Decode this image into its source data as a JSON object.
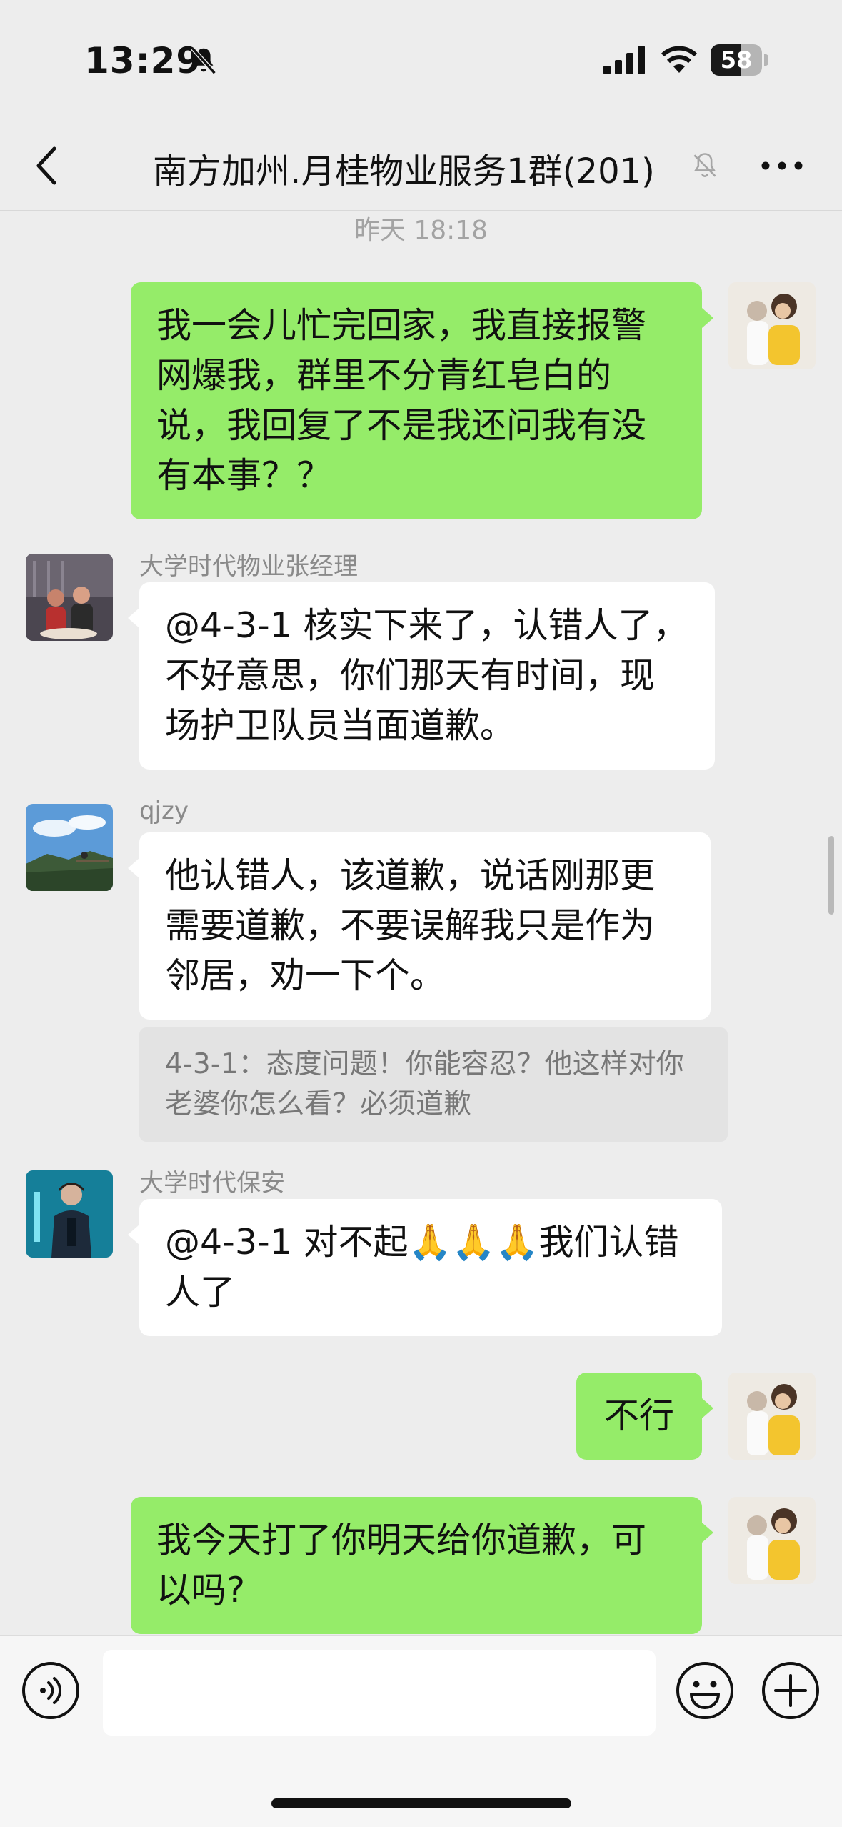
{
  "status_bar": {
    "time": "13:29",
    "battery_level": "58",
    "battery_fraction": 0.58
  },
  "navbar": {
    "title": "南方加州.月桂物业服务1群(201)"
  },
  "chat": {
    "timestamp": "昨天 18:18",
    "messages": [
      {
        "side": "me",
        "text": "我一会儿忙完回家，我直接报警网爆我，群里不分青红皂白的说，我回复了不是我还问我有没有本事？？"
      },
      {
        "side": "other",
        "sender": "大学时代物业张经理",
        "text": "@4-3-1 核实下来了，认错人了，不好意思，你们那天有时间，现场护卫队员当面道歉。"
      },
      {
        "side": "other",
        "sender": "qjzy",
        "text": "他认错人，该道歉，说话刚那更需要道歉，不要误解我只是作为邻居，劝一下个。",
        "quote": "4-3-1：态度问题！你能容忍？他这样对你老婆你怎么看？必须道歉"
      },
      {
        "side": "other",
        "sender": "大学时代保安",
        "text": "@4-3-1 对不起🙏🙏🙏我们认错人了"
      },
      {
        "side": "me",
        "text": "不行"
      },
      {
        "side": "me",
        "text": "我今天打了你明天给你道歉，可以吗?"
      }
    ]
  },
  "icons": {
    "back": "chevron-left-icon",
    "mute": "bell-off-icon",
    "more": "more-icon",
    "voice": "voice-icon",
    "emoji": "emoji-icon",
    "plus": "plus-icon"
  },
  "colors": {
    "my_bubble": "#95ec69",
    "other_bubble": "#ffffff",
    "background": "#ededed"
  }
}
